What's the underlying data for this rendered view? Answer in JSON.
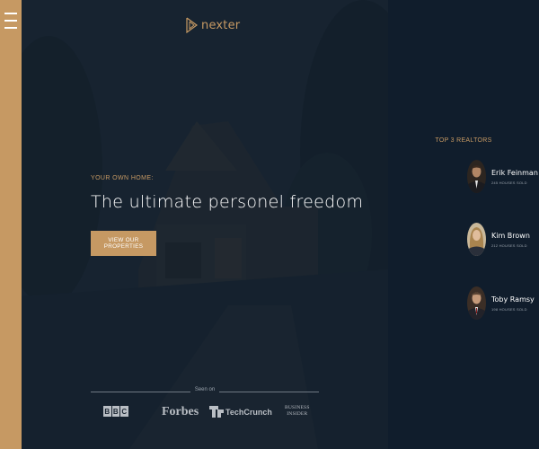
{
  "menu": {
    "icon": "hamburger-menu-icon"
  },
  "brand": {
    "name": "nexter",
    "icon": "nexter-logo-icon",
    "color": "#c69963"
  },
  "hero": {
    "sub_heading": "YOUR OWN HOME:",
    "heading": "The ultimate personel freedom",
    "cta_label": "VIEW OUR PROPERTIES",
    "background_overlay": "#101d2c"
  },
  "seen_on": {
    "label": "Seen on",
    "logos": [
      {
        "name": "BBC",
        "letters": [
          "B",
          "B",
          "C"
        ]
      },
      {
        "name": "Forbes",
        "text": "Forbes"
      },
      {
        "name": "TechCrunch",
        "text": "TechCrunch"
      },
      {
        "name": "Business Insider",
        "lines": [
          "BUSINESS",
          "INSIDER"
        ]
      }
    ]
  },
  "realtors": {
    "title": "TOP 3 REALTORS",
    "items": [
      {
        "name": "Erik Feinman",
        "sold": "245 HOUSES SOLD"
      },
      {
        "name": "Kim Brown",
        "sold": "212 HOUSES SOLD"
      },
      {
        "name": "Toby Ramsy",
        "sold": "198 HOUSES SOLD"
      }
    ]
  },
  "colors": {
    "primary": "#c69963",
    "dark": "#101d2c",
    "white": "#ffffff"
  }
}
